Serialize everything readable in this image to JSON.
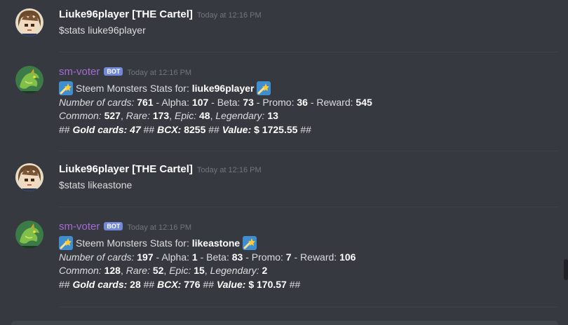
{
  "colors": {
    "background": "#36393f",
    "bot_name": "#a36cd1",
    "bot_tag": "#7289da",
    "timestamp": "#72767d"
  },
  "messages": [
    {
      "username": "Liuke96player [THE Cartel]",
      "timestamp": "Today at 12:16 PM",
      "text": "$stats liuke96player",
      "avatar_icon": "anime-avatar"
    },
    {
      "username": "sm-voter",
      "bot_tag": "BOT",
      "timestamp": "Today at 12:16 PM",
      "avatar_icon": "dragon-avatar",
      "emoji_icon": "shooting-star-emoji",
      "stats_label": "Steem Monsters Stats for:",
      "player": "liuke96player",
      "number_of_cards_label": "Number of cards:",
      "number_of_cards": "761",
      "alpha_label": "Alpha:",
      "alpha": "107",
      "beta_label": "Beta:",
      "beta": "73",
      "promo_label": "Promo:",
      "promo": "36",
      "reward_label": "Reward:",
      "reward": "545",
      "common_label": "Common:",
      "common": "527",
      "rare_label": "Rare:",
      "rare": "173",
      "epic_label": "Epic:",
      "epic": "48",
      "legendary_label": "Legendary:",
      "legendary": "13",
      "gold_label": "Gold cards: 47",
      "bcx_label": "BCX:",
      "bcx": "8255",
      "value_label": "Value:",
      "value": "$ 1725.55"
    },
    {
      "username": "Liuke96player [THE Cartel]",
      "timestamp": "Today at 12:16 PM",
      "text": "$stats likeastone",
      "avatar_icon": "anime-avatar"
    },
    {
      "username": "sm-voter",
      "bot_tag": "BOT",
      "timestamp": "Today at 12:16 PM",
      "avatar_icon": "dragon-avatar",
      "emoji_icon": "shooting-star-emoji",
      "stats_label": "Steem Monsters Stats for:",
      "player": "likeastone",
      "number_of_cards_label": "Number of cards:",
      "number_of_cards": "197",
      "alpha_label": "Alpha:",
      "alpha": "1",
      "beta_label": "Beta:",
      "beta": "83",
      "promo_label": "Promo:",
      "promo": "7",
      "reward_label": "Reward:",
      "reward": "106",
      "common_label": "Common:",
      "common": "128",
      "rare_label": "Rare:",
      "rare": "52",
      "epic_label": "Epic:",
      "epic": "15",
      "legendary_label": "Legendary:",
      "legendary": "2",
      "gold_label": "Gold cards:",
      "gold": "28",
      "bcx_label": "BCX:",
      "bcx": "776",
      "value_label": "Value:",
      "value": "$ 170.57"
    }
  ],
  "separators": {
    "hash": "##",
    "dash": "-",
    "comma": ","
  }
}
